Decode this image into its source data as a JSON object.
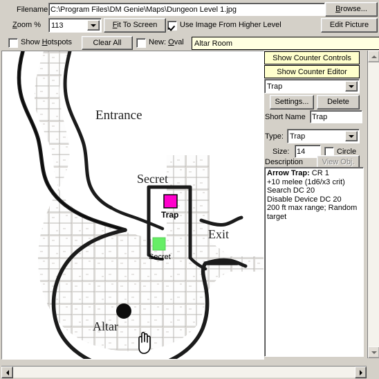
{
  "toolbar": {
    "filename_label": "Filename",
    "filename_value": "C:\\Program Files\\DM Genie\\Maps\\Dungeon Level 1.jpg",
    "browse_label": "Browse...",
    "zoom_label_pre": "Z",
    "zoom_label_post": "oom %",
    "zoom_value": "113",
    "fit_label_pre": "F",
    "fit_label_post": "it To Screen",
    "use_image_label": "Use Image From Higher Level",
    "use_image_checked": true,
    "edit_picture_label": "Edit Picture",
    "show_hotspots_label_pre": "Show ",
    "show_hotspots_label_key": "H",
    "show_hotspots_label_post": "otspots",
    "show_hotspots_checked": false,
    "clear_all_label": "Clear All",
    "new_oval_label_pre": "New: ",
    "new_oval_label_key": "O",
    "new_oval_label_post": "val",
    "new_oval_checked": false,
    "room_name_value": "Altar Room"
  },
  "editor": {
    "show_counter_controls_label": "Show Counter Controls",
    "show_counter_editor_label": "Show Counter Editor",
    "object_select_value": "Trap",
    "settings_label": "Settings...",
    "delete_label": "Delete",
    "short_name_label": "Short Name",
    "short_name_value": "Trap",
    "type_label": "Type:",
    "type_value": "Trap",
    "size_label": "Size:",
    "size_value": "14",
    "circle_label": "Circle",
    "circle_checked": false,
    "description_label": "Description",
    "view_obj_label": "View Obj.",
    "description_title": "Arrow Trap:",
    "description_lines": [
      " CR 1",
      "+10 melee (1d6/x3 crit)",
      "Search DC 20",
      "Disable Device DC 20",
      "200 ft max range; Random",
      "target"
    ]
  },
  "map": {
    "label_entrance": "Entrance",
    "label_secret_room": "Secret",
    "label_trap_marker": "Trap",
    "label_secret_marker": "Secret",
    "label_exit": "Exit",
    "label_altar": "Altar",
    "trap_color": "#ff00cc",
    "secret_color": "#66ee66"
  }
}
